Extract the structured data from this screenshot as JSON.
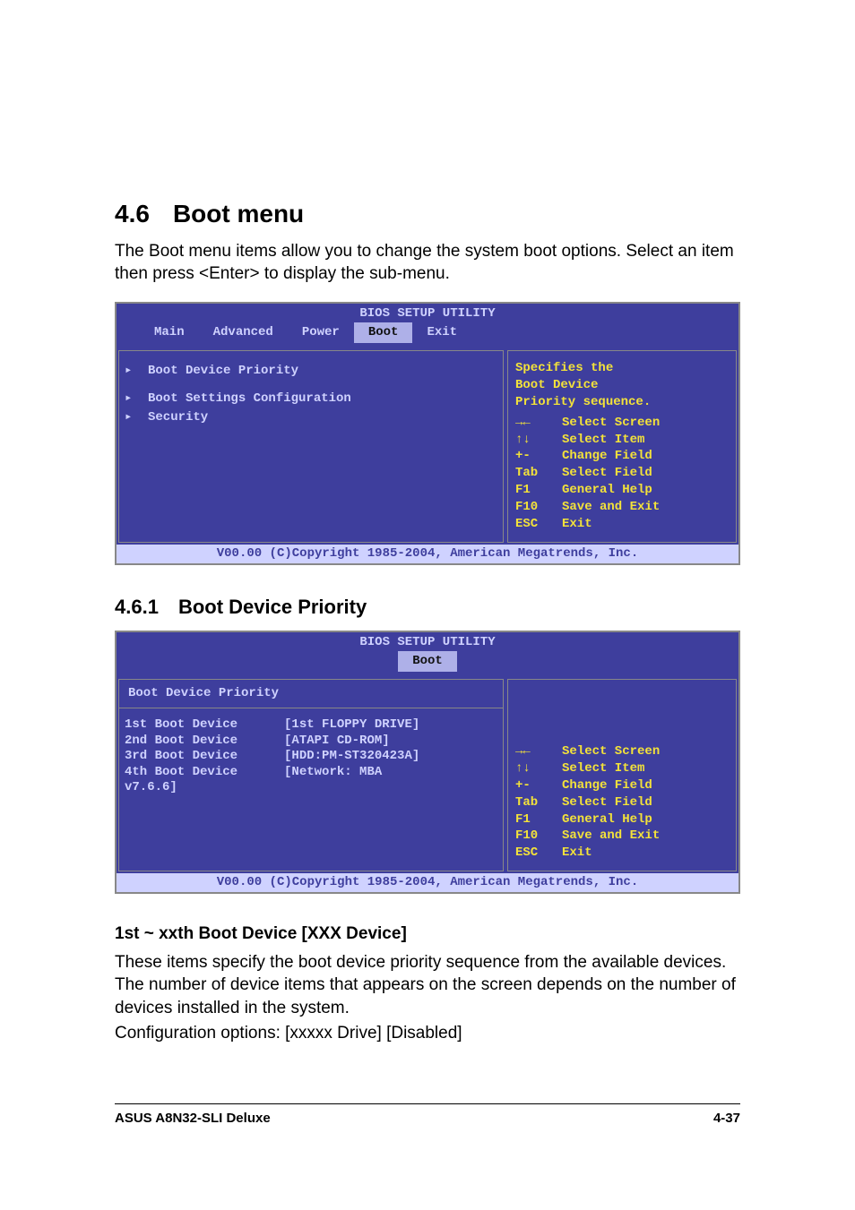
{
  "section": {
    "number": "4.6",
    "title": "Boot menu"
  },
  "intro": "The Boot menu items allow you to change the system boot options. Select an item then press <Enter> to display the sub-menu.",
  "bios1": {
    "title": "BIOS SETUP UTILITY",
    "tabs": {
      "main": "Main",
      "advanced": "Advanced",
      "power": "Power",
      "boot": "Boot",
      "exit": "Exit"
    },
    "menu": {
      "row0": "Boot Device Priority",
      "row1": "Boot Settings Configuration",
      "row2": "Security"
    },
    "help": {
      "line0": "Specifies the",
      "line1": "Boot Device",
      "line2": "Priority sequence."
    },
    "keys": {
      "k0": {
        "key": "→←",
        "label": "Select Screen"
      },
      "k1": {
        "key": "↑↓",
        "label": "Select Item"
      },
      "k2": {
        "key": "+-",
        "label": "Change Field"
      },
      "k3": {
        "key": "Tab",
        "label": "Select Field"
      },
      "k4": {
        "key": "F1",
        "label": "General Help"
      },
      "k5": {
        "key": "F10",
        "label": "Save and Exit"
      },
      "k6": {
        "key": "ESC",
        "label": "Exit"
      }
    },
    "footer": "V00.00 (C)Copyright 1985-2004, American Megatrends, Inc."
  },
  "subsection": {
    "number": "4.6.1",
    "title": "Boot Device Priority"
  },
  "bios2": {
    "title": "BIOS SETUP UTILITY",
    "tab": "Boot",
    "header": "Boot Device Priority",
    "labels": {
      "l0": "1st Boot Device",
      "l1": "2nd Boot Device",
      "l2": "3rd Boot Device",
      "l3": "4th Boot Device",
      "l4": "v7.6.6]"
    },
    "values": {
      "v0": "[1st FLOPPY DRIVE]",
      "v1": "[ATAPI CD-ROM]",
      "v2": "[HDD:PM-ST320423A]",
      "v3": "[Network: MBA"
    },
    "keys": {
      "k0": {
        "key": "→←",
        "label": "Select Screen"
      },
      "k1": {
        "key": "↑↓",
        "label": "Select Item"
      },
      "k2": {
        "key": "+-",
        "label": "Change Field"
      },
      "k3": {
        "key": "Tab",
        "label": "Select Field"
      },
      "k4": {
        "key": "F1",
        "label": "General Help"
      },
      "k5": {
        "key": "F10",
        "label": "Save and Exit"
      },
      "k6": {
        "key": "ESC",
        "label": "Exit"
      }
    },
    "footer": "V00.00 (C)Copyright 1985-2004, American Megatrends, Inc."
  },
  "item_heading": "1st ~ xxth Boot Device [XXX Device]",
  "item_desc1": "These items specify the boot device priority sequence from the available devices. The number of device items that appears on the screen depends on the number of devices installed in the system.",
  "item_desc2": "Configuration options: [xxxxx Drive] [Disabled]",
  "footer": {
    "left": "ASUS A8N32-SLI Deluxe",
    "right": "4-37"
  }
}
